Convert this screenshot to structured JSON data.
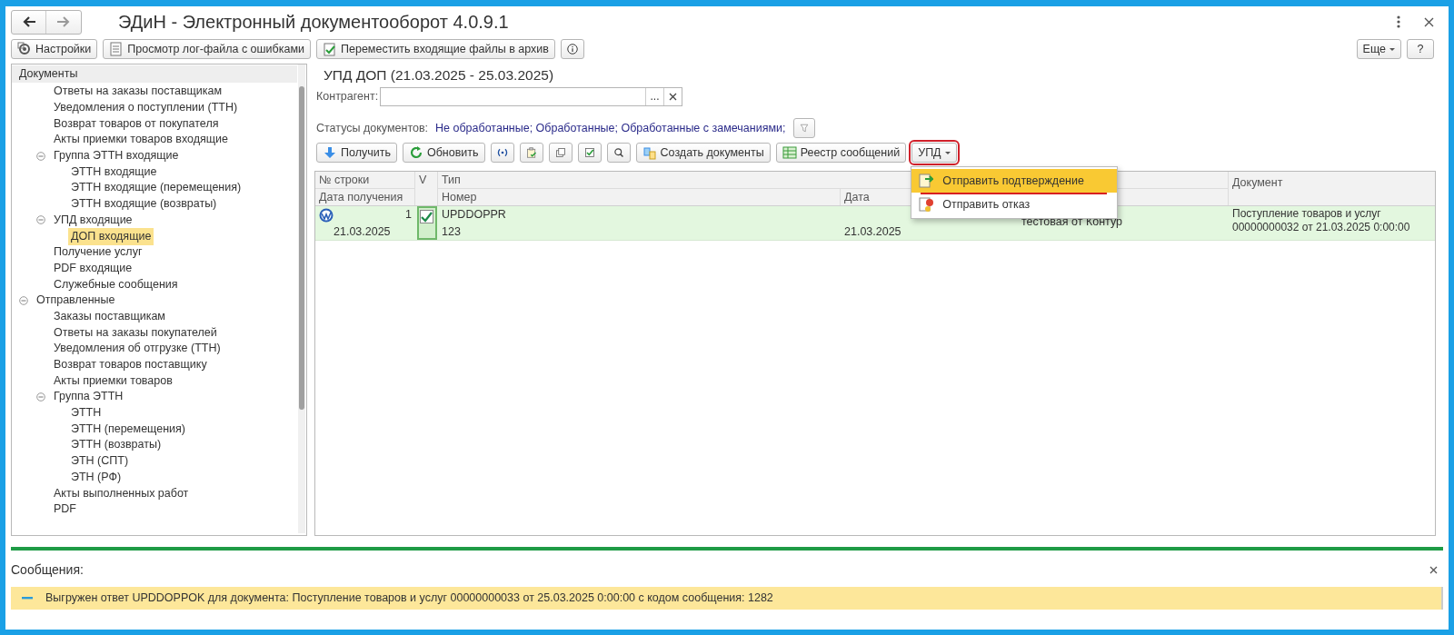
{
  "window": {
    "title": "ЭДиН - Электронный документооборот 4.0.9.1"
  },
  "toolbar": [
    "Настройки",
    "Просмотр лог-файла с ошибками",
    "Переместить входящие файлы в архив"
  ],
  "more_button": {
    "label": "Еще"
  },
  "help_button": {
    "label": "?"
  },
  "tree": [
    {
      "label": "Документы",
      "kind": "header",
      "selected": false,
      "children": [
        {
          "label": "Ответы на заказы поставщикам",
          "selected": false
        },
        {
          "label": "Уведомления о поступлении (ТТН)",
          "selected": false
        },
        {
          "label": "Возврат товаров от покупателя",
          "selected": false
        },
        {
          "label": "Акты приемки товаров входящие",
          "selected": false
        },
        {
          "label": "Группа ЭТТН входящие",
          "selected": false,
          "expanded": true,
          "children": [
            {
              "label": "ЭТТН входящие",
              "selected": false
            },
            {
              "label": "ЭТТН входящие (перемещения)",
              "selected": false
            },
            {
              "label": "ЭТТН входящие (возвраты)",
              "selected": false
            }
          ]
        },
        {
          "label": "УПД входящие",
          "selected": false,
          "expanded": true,
          "children": [
            {
              "label": "ДОП входящие",
              "selected": true
            }
          ]
        },
        {
          "label": "Получение услуг",
          "selected": false
        },
        {
          "label": "PDF входящие",
          "selected": false
        },
        {
          "label": "Служебные сообщения",
          "selected": false
        }
      ]
    },
    {
      "label": "Отправленные",
      "kind": "group",
      "selected": false,
      "expanded": true,
      "children": [
        {
          "label": "Заказы поставщикам",
          "selected": false
        },
        {
          "label": "Ответы на заказы покупателей",
          "selected": false
        },
        {
          "label": "Уведомления об отгрузке (ТТН)",
          "selected": false
        },
        {
          "label": "Возврат товаров поставщику",
          "selected": false
        },
        {
          "label": "Акты приемки товаров",
          "selected": false
        },
        {
          "label": "Группа ЭТТН",
          "selected": false,
          "expanded": true,
          "children": [
            {
              "label": "ЭТТН",
              "selected": false
            },
            {
              "label": "ЭТТН (перемещения)",
              "selected": false
            },
            {
              "label": "ЭТТН (возвраты)",
              "selected": false
            },
            {
              "label": "ЭТН (СПТ)",
              "selected": false
            },
            {
              "label": "ЭТН (РФ)",
              "selected": false
            }
          ]
        },
        {
          "label": "Акты выполненных работ",
          "selected": false
        },
        {
          "label": "PDF",
          "selected": false
        }
      ]
    }
  ],
  "form": {
    "title": "УПД ДОП (21.03.2025 - 25.03.2025)",
    "counterparty": {
      "label": "Контрагент:",
      "choose": "..."
    },
    "statuses": {
      "label": "Статусы документов:",
      "value": "Не обработанные; Обработанные; Обработанные с замечаниями;"
    }
  },
  "actions": [
    {
      "kind": "labeled",
      "label": "Получить"
    },
    {
      "kind": "labeled",
      "label": "Обновить"
    },
    {
      "kind": "icon"
    },
    {
      "kind": "icon"
    },
    {
      "kind": "icon"
    },
    {
      "kind": "icon"
    },
    {
      "kind": "icon"
    },
    {
      "kind": "labeled",
      "label": "Создать документы"
    },
    {
      "kind": "labeled",
      "label": "Реестр сообщений"
    }
  ],
  "upd_menu": {
    "label": "УПД",
    "highlighted": true,
    "open": true,
    "items": [
      {
        "label": "Отправить подтверждение",
        "selected": true
      },
      {
        "label": "Отправить отказ",
        "selected": false
      }
    ]
  },
  "table": {
    "header": {
      "row_number": "№ строки",
      "received": "Дата получения",
      "check": "V",
      "type": "Тип",
      "number": "Номер",
      "date": "Дата",
      "document": "Документ"
    },
    "rows": [
      {
        "selected": true,
        "checked": true,
        "row_number": "1",
        "received": "21.03.2025",
        "type": "UPDDOPPR",
        "number": "123",
        "date": "21.03.2025",
        "column_5": "тестовая от Контур",
        "document": "Поступление товаров и услуг 00000000032 от 21.03.2025 0:00:00"
      }
    ]
  },
  "messages": {
    "title": "Сообщения:",
    "items": [
      {
        "text": "Выгружен ответ UPDDOPPOK для документа: Поступление товаров и услуг 00000000033 от 25.03.2025 0:00:00 с кодом сообщения: 1282"
      }
    ]
  }
}
